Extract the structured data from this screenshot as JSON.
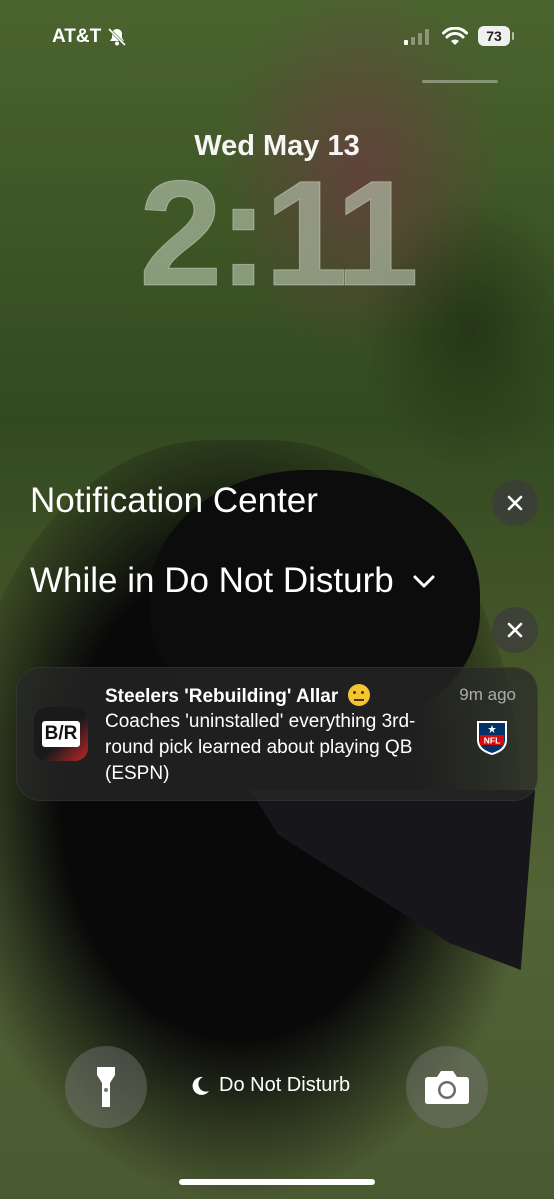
{
  "status_bar": {
    "carrier": "AT&T",
    "battery": "73"
  },
  "lock_screen": {
    "date": "Wed May 13",
    "time": "2:11"
  },
  "notification_center": {
    "title": "Notification Center",
    "section_label": "While in Do Not Disturb"
  },
  "notification": {
    "title": "Steelers 'Rebuilding' Allar",
    "time_ago": "9m ago",
    "body": "Coaches 'uninstalled' everything 3rd-round pick learned about playing QB (ESPN)",
    "app_icon_text": "B/R",
    "attachment_icon": "nfl-logo"
  },
  "bottom": {
    "focus_label": "Do Not Disturb"
  },
  "colors": {
    "notification_bg": "#282828",
    "close_button_bg": "#3c3c3c",
    "br_red": "#c0262b"
  }
}
